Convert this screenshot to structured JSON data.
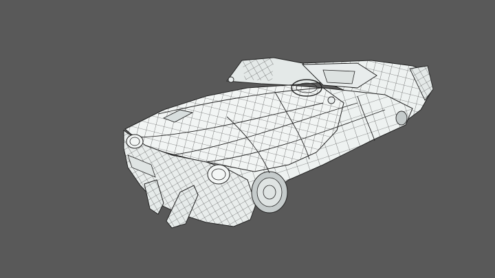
{
  "viewport": {
    "background": "#595959",
    "mode": "wireframe-on-shaded",
    "subject": "convertible-car-model"
  },
  "colors": {
    "surface": "#f1f5f4",
    "surface_shade": "#dfe4e3",
    "surface_dark": "#c9cfcf",
    "wire": "#2a2a2a",
    "tire": "#bfc5c5",
    "interior": "#e8ecec"
  }
}
